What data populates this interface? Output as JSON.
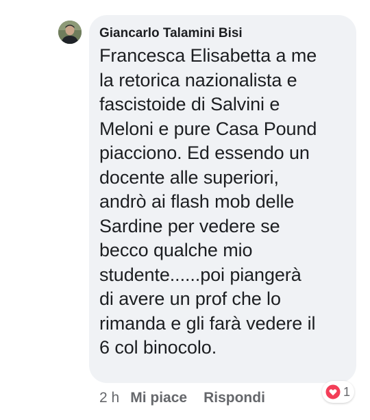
{
  "comment": {
    "author": "Giancarlo Talamini Bisi",
    "text": "Francesca Elisabetta a me\nla retorica nazionalista e\nfascistoide di Salvini e\nMeloni e pure Casa Pound\npiacciono. Ed essendo un\ndocente alle superiori,\nandrò ai flash mob delle\nSardine per vedere se\nbecco qualche mio\nstudente......poi piangerà\ndi avere un prof che lo\nrimanda e gli farà vedere il\n6 col binocolo.",
    "timestamp": "2 h",
    "like_label": "Mi piace",
    "reply_label": "Rispondi",
    "reaction_icon": "heart-icon",
    "reaction_color": "#f33e58",
    "reaction_count": "1"
  },
  "colors": {
    "bubble": "#f0f2f5",
    "text": "#1c1e21",
    "secondary": "#65676b"
  }
}
